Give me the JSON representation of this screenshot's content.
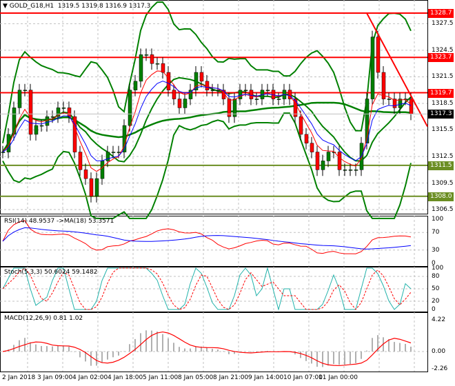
{
  "header": {
    "symbol": "GOLD_G18,H1",
    "ohlc": "1319.5 1319.8 1316.9 1317.3"
  },
  "price_axis": [
    "1327.5",
    "1324.5",
    "1321.5",
    "1318.5",
    "1315.5",
    "1312.5",
    "1309.5",
    "1306.5"
  ],
  "levels": [
    {
      "label": "1328.7",
      "value": 1328.7,
      "color": "#ff0000"
    },
    {
      "label": "1323.7",
      "value": 1323.7,
      "color": "#ff0000"
    },
    {
      "label": "1319.7",
      "value": 1319.7,
      "color": "#ff0000"
    },
    {
      "label": "1311.5",
      "value": 1311.5,
      "color": "#6b8e23"
    },
    {
      "label": "1308.0",
      "value": 1308.0,
      "color": "#6b8e23"
    }
  ],
  "current_price": {
    "label": "1317.3",
    "value": 1317.3
  },
  "rsi": {
    "title": "RSI(14) 48.9537  ->MA(18) 53.3571",
    "axis": [
      "100",
      "70",
      "30",
      "0"
    ]
  },
  "stoch": {
    "title": "Stoch(5,3,3) 50.6024 59.1482",
    "axis": [
      "100",
      "80",
      "50",
      "20",
      "0"
    ]
  },
  "macd": {
    "title": "MACD(12,26,9) 0.81 1.02",
    "axis": [
      "4.22",
      "0.00",
      "-2.26"
    ]
  },
  "time_axis": [
    "2 Jan 2018",
    "3 Jan 09:00",
    "4 Jan 02:00",
    "4 Jan 18:00",
    "5 Jan 11:00",
    "8 Jan 05:00",
    "8 Jan 21:00",
    "9 Jan 14:00",
    "10 Jan 07:00",
    "11 Jan 00:00"
  ],
  "chart_data": {
    "type": "candlestick",
    "closes": [
      1313,
      1315,
      1318,
      1320,
      1320,
      1315,
      1316,
      1316,
      1317,
      1317,
      1318,
      1318,
      1317,
      1313,
      1311,
      1310,
      1308,
      1310,
      1312,
      1313,
      1313,
      1313,
      1316,
      1320,
      1321,
      1324,
      1324,
      1323,
      1323,
      1322,
      1320,
      1319,
      1318,
      1319,
      1320,
      1322,
      1321,
      1320,
      1320,
      1320,
      1319,
      1317,
      1319,
      1320,
      1320,
      1319,
      1319,
      1320,
      1320,
      1319,
      1319,
      1320,
      1319,
      1317,
      1315,
      1314,
      1313,
      1311,
      1312,
      1313,
      1313,
      1311,
      1311,
      1311,
      1311,
      1314,
      1319,
      1326,
      1322,
      1319,
      1319,
      1318,
      1319,
      1319,
      1317.3
    ],
    "ylim": [
      1305.5,
      1330.2
    ],
    "trendline": [
      [
        1328.7,
        66
      ],
      [
        1319,
        74
      ]
    ]
  }
}
